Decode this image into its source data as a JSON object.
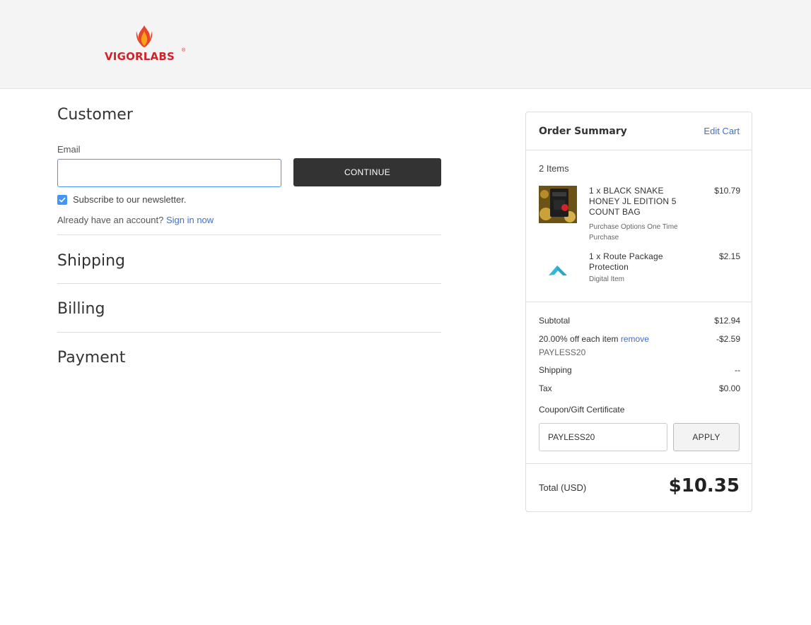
{
  "header": {
    "brand": "VIGORLABS",
    "brand_reg": "®",
    "brand_color": "#d1232a"
  },
  "customer": {
    "title": "Customer",
    "email_label": "Email",
    "email_value": "",
    "continue_label": "CONTINUE",
    "newsletter_checked": true,
    "newsletter_label": "Subscribe to our newsletter.",
    "account_prompt": "Already have an account?",
    "signin_label": "Sign in now"
  },
  "steps": {
    "shipping": "Shipping",
    "billing": "Billing",
    "payment": "Payment"
  },
  "summary": {
    "title": "Order Summary",
    "edit_cart": "Edit Cart",
    "items_count": "2 Items",
    "items": [
      {
        "name": "1 x BLACK SNAKE HONEY JL EDITION 5 COUNT BAG",
        "sub": "Purchase Options One Time Purchase",
        "price": "$10.79",
        "icon": "product-image"
      },
      {
        "name": "1 x Route Package Protection",
        "sub": "Digital Item",
        "price": "$2.15",
        "icon": "route-logo-icon"
      }
    ],
    "subtotal_label": "Subtotal",
    "subtotal_value": "$12.94",
    "discount_label": "20.00% off each item",
    "discount_remove": "remove",
    "discount_value": "-$2.59",
    "discount_code": "PAYLESS20",
    "shipping_label": "Shipping",
    "shipping_value": "--",
    "tax_label": "Tax",
    "tax_value": "$0.00",
    "coupon_label": "Coupon/Gift Certificate",
    "coupon_value": "PAYLESS20",
    "apply_label": "APPLY",
    "total_label": "Total (USD)",
    "total_value": "$10.35"
  },
  "colors": {
    "accent": "#4496f6",
    "link": "#3d6fd1",
    "button_dark": "#333333"
  }
}
